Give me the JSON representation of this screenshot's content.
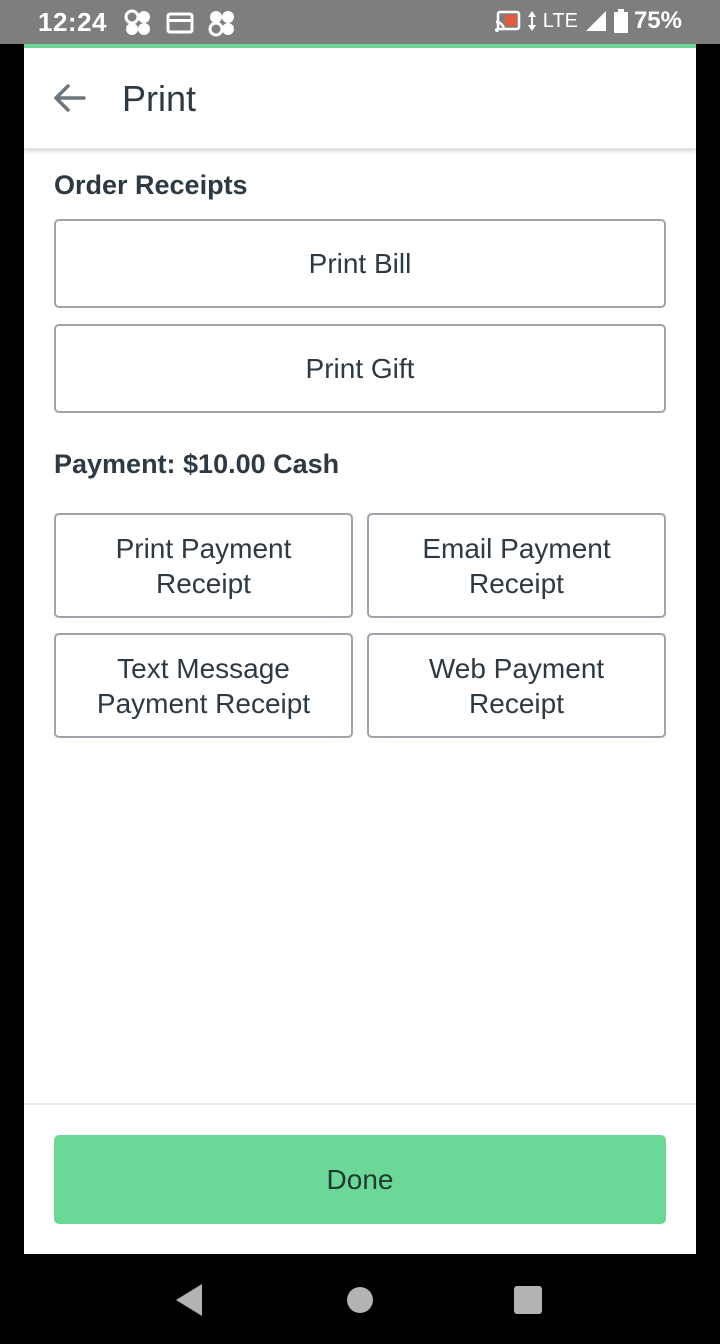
{
  "status_bar": {
    "time": "12:24",
    "network": "LTE",
    "battery": "75%",
    "left_icons": [
      "clover-icon",
      "card-icon",
      "clover-sync-icon"
    ],
    "right_icons": [
      "cast-icon",
      "data-arrows-icon",
      "signal-icon",
      "battery-icon"
    ]
  },
  "app_bar": {
    "title": "Print",
    "back_icon": "arrow-left-icon"
  },
  "order_receipts": {
    "label": "Order Receipts",
    "buttons": [
      {
        "label": "Print Bill"
      },
      {
        "label": "Print Gift"
      }
    ]
  },
  "payment": {
    "label": "Payment: $10.00 Cash",
    "buttons": [
      {
        "line1": "Print Payment",
        "line2": "Receipt"
      },
      {
        "line1": "Email Payment",
        "line2": "Receipt"
      },
      {
        "line1": "Text Message",
        "line2": "Payment Receipt"
      },
      {
        "line1": "Web Payment",
        "line2": "Receipt"
      }
    ]
  },
  "footer": {
    "done_label": "Done"
  },
  "nav_bar": {
    "buttons": [
      "back-triangle-icon",
      "home-circle-icon",
      "recents-square-icon"
    ]
  },
  "colors": {
    "status_bar_bg": "#7e7e7e",
    "accent_green": "#6cd897",
    "text_dark": "#2d3a44",
    "border_gray": "#9ea4a9"
  }
}
